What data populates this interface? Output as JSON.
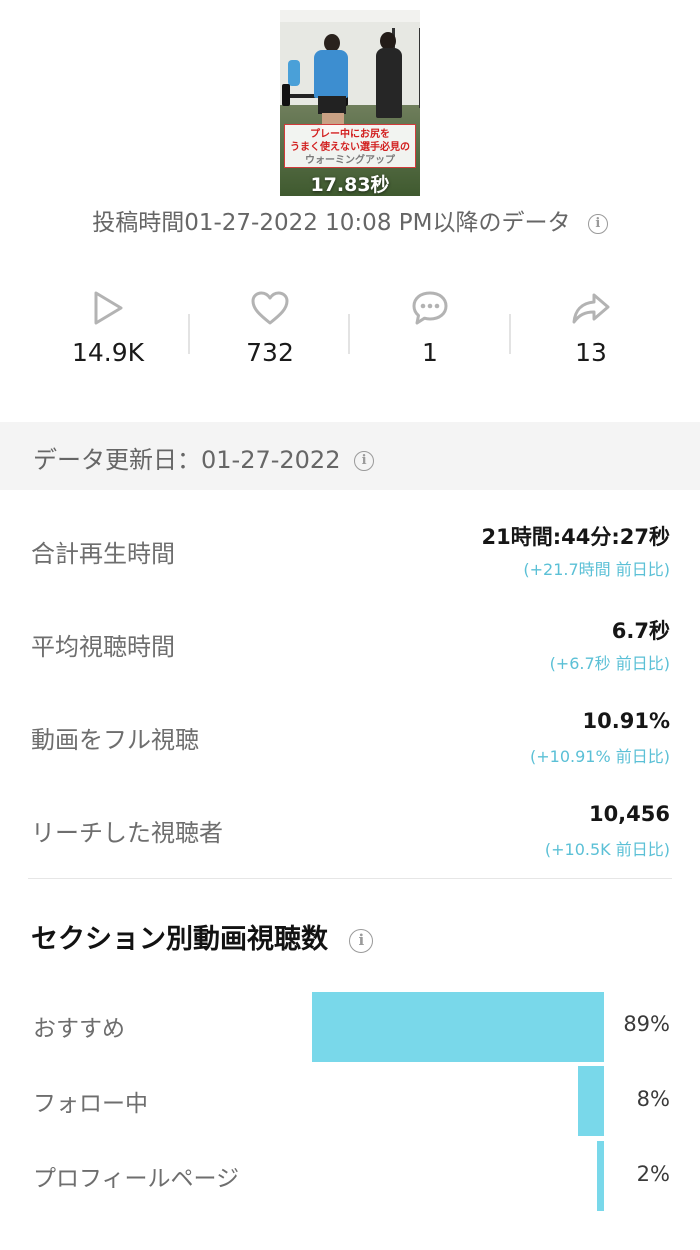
{
  "video": {
    "caption_line1": "プレー中にお尻を",
    "caption_line2": "うまく使えない選手必見の",
    "caption_line3": "ウォーミングアップ",
    "duration": "17.83秒"
  },
  "posted_text": "投稿時間01-27-2022 10:08 PM以降のデータ",
  "stats": {
    "views": "14.9K",
    "likes": "732",
    "comments": "1",
    "shares": "13"
  },
  "updated_text": "データ更新日：01-27-2022",
  "metrics": [
    {
      "label": "合計再生時間",
      "value": "21時間:44分:27秒",
      "delta": "(+21.7時間 前日比)"
    },
    {
      "label": "平均視聴時間",
      "value": "6.7秒",
      "delta": "(+6.7秒 前日比)"
    },
    {
      "label": "動画をフル視聴",
      "value": "10.91%",
      "delta": "(+10.91% 前日比)"
    },
    {
      "label": "リーチした視聴者",
      "value": "10,456",
      "delta": "(+10.5K 前日比)"
    }
  ],
  "section_title": "セクション別動画視聴数",
  "traffic_sources": [
    {
      "label": "おすすめ",
      "percent_text": "89%",
      "percent": 89
    },
    {
      "label": "フォロー中",
      "percent_text": "8%",
      "percent": 8
    },
    {
      "label": "プロフィールページ",
      "percent_text": "2%",
      "percent": 2
    }
  ],
  "colors": {
    "bar": "#79d8ea",
    "delta": "#5bc0d6",
    "icon": "#b3b3b3"
  },
  "icons": [
    "play-icon",
    "heart-icon",
    "comment-icon",
    "share-icon",
    "info-icon"
  ],
  "info_glyph": "i"
}
